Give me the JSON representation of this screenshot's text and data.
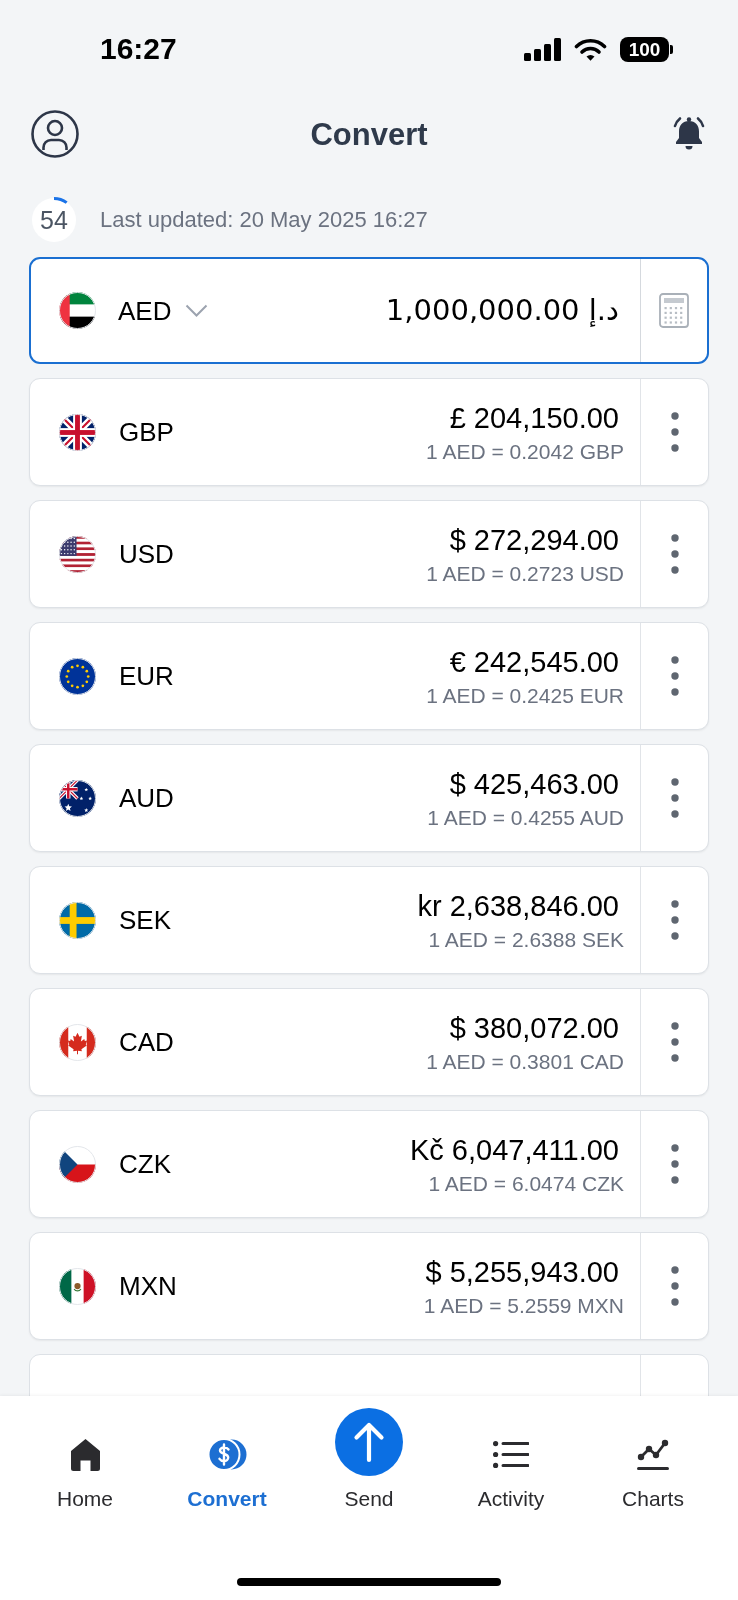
{
  "status_bar": {
    "time": "16:27",
    "battery": "100"
  },
  "header": {
    "title": "Convert"
  },
  "refresh": {
    "countdown": "54",
    "level": 0.1,
    "last_updated": "Last updated: 20 May 2025 16:27"
  },
  "base_currency": {
    "code": "AED",
    "amount": "1,000,000.00 د.إ",
    "focused": true
  },
  "currencies": [
    {
      "code": "GBP",
      "amount": "£ 204,150.00",
      "rate": "1 AED = 0.2042 GBP"
    },
    {
      "code": "USD",
      "amount": "$ 272,294.00",
      "rate": "1 AED = 0.2723 USD"
    },
    {
      "code": "EUR",
      "amount": "€ 242,545.00",
      "rate": "1 AED = 0.2425 EUR"
    },
    {
      "code": "AUD",
      "amount": "$ 425,463.00",
      "rate": "1 AED = 0.4255 AUD"
    },
    {
      "code": "SEK",
      "amount": "kr 2,638,846.00",
      "rate": "1 AED = 2.6388 SEK"
    },
    {
      "code": "CAD",
      "amount": "$ 380,072.00",
      "rate": "1 AED = 0.3801 CAD"
    },
    {
      "code": "CZK",
      "amount": "Kč 6,047,411.00",
      "rate": "1 AED = 6.0474 CZK"
    },
    {
      "code": "MXN",
      "amount": "$ 5,255,943.00",
      "rate": "1 AED = 5.2559 MXN"
    }
  ],
  "tab_bar": [
    {
      "label": "Home",
      "selected": false,
      "kind": "tab"
    },
    {
      "label": "Convert",
      "selected": true,
      "kind": "tab"
    },
    {
      "label": "Send",
      "selected": false,
      "kind": "action"
    },
    {
      "label": "Activity",
      "selected": false,
      "kind": "tab"
    },
    {
      "label": "Charts",
      "selected": false,
      "kind": "tab"
    }
  ]
}
